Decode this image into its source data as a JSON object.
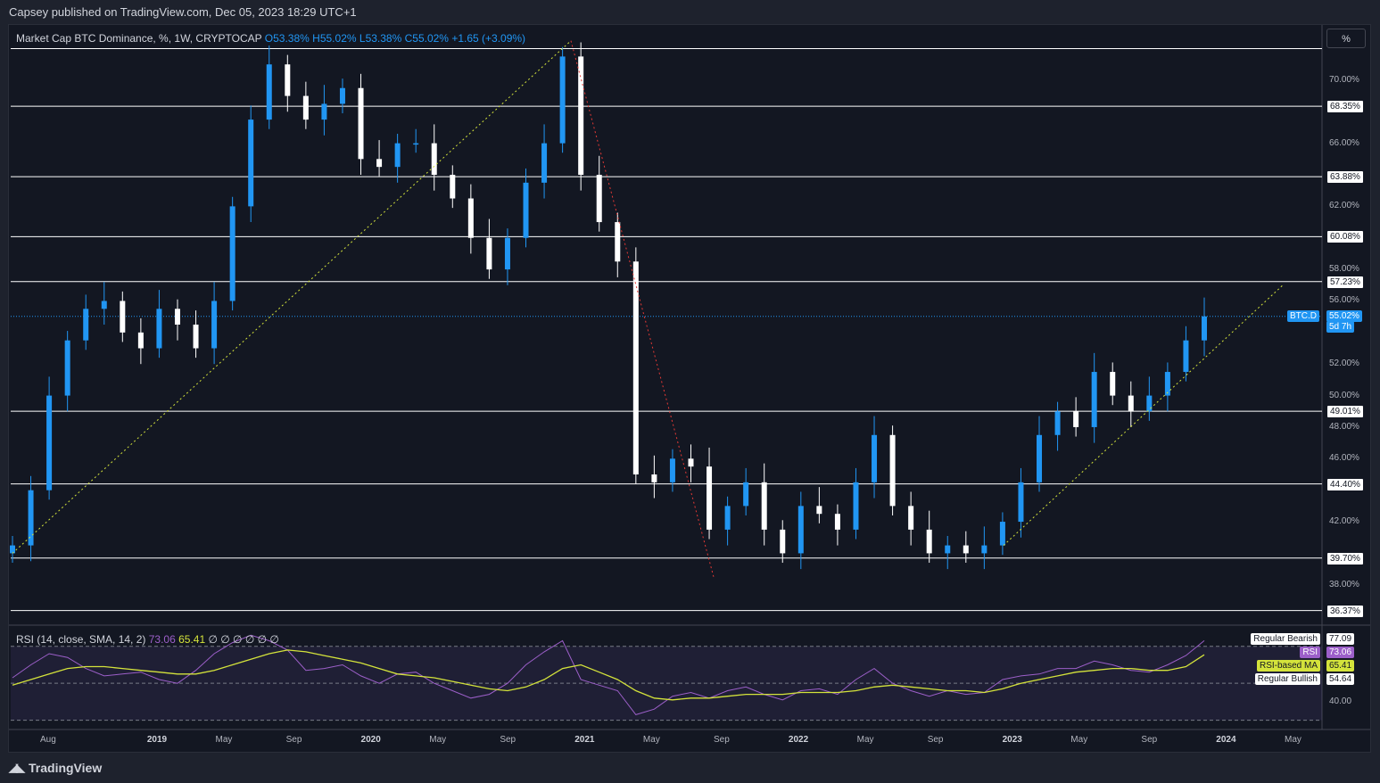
{
  "header": {
    "publisher": "Capsey published on TradingView.com, Dec 05, 2023 18:29 UTC+1"
  },
  "legend": {
    "symbol": "Market Cap BTC Dominance, %, 1W, CRYPTOCAP",
    "open": "O53.38%",
    "high": "H55.02%",
    "low": "L53.38%",
    "close": "C55.02%",
    "change": "+1.65 (+3.09%)"
  },
  "scale_button": "%",
  "footer": {
    "brand": "TradingView"
  },
  "rsi_legend": {
    "title": "RSI (14, close, SMA, 14, 2)",
    "rsi_value": "73.06",
    "ma_value": "65.41",
    "empties": "∅ ∅ ∅ ∅ ∅ ∅"
  },
  "colors": {
    "up": "#2196f3",
    "down": "#ffffff",
    "rsi": "#9c5fc9",
    "rsi_ma": "#d4e33b",
    "hline": "#ffffff",
    "dotted_up": "#d4e33b",
    "dotted_down": "#e53935"
  },
  "price_axis": [
    "70.00%",
    "66.00%",
    "62.00%",
    "58.00%",
    "56.00%",
    "52.00%",
    "50.00%",
    "48.00%",
    "46.00%",
    "42.00%",
    "38.00%"
  ],
  "hlines": [
    {
      "value": 72.0,
      "label": ""
    },
    {
      "value": 68.35,
      "label": "68.35%"
    },
    {
      "value": 63.88,
      "label": "63.88%"
    },
    {
      "value": 60.08,
      "label": "60.08%"
    },
    {
      "value": 57.23,
      "label": "57.23%"
    },
    {
      "value": 49.01,
      "label": "49.01%"
    },
    {
      "value": 44.4,
      "label": "44.40%"
    },
    {
      "value": 39.7,
      "label": "39.70%"
    },
    {
      "value": 36.37,
      "label": "36.37%"
    }
  ],
  "current_price": {
    "symbol": "BTC.D",
    "value": "55.02%",
    "countdown": "5d 7h",
    "level": 55.02
  },
  "rsi_tags": [
    {
      "name": "Regular Bearish",
      "value": "77.09"
    },
    {
      "name": "RSI",
      "value": "73.06"
    },
    {
      "name": "RSI-based MA",
      "value": "65.41"
    },
    {
      "name": "Regular Bullish",
      "value": "54.64"
    }
  ],
  "rsi_axis": [
    "40.00"
  ],
  "time_axis": [
    {
      "label": "Aug",
      "t": 0.0
    },
    {
      "label": "2019",
      "t": 0.5
    },
    {
      "label": "May",
      "t": 0.82
    },
    {
      "label": "Sep",
      "t": 1.15
    },
    {
      "label": "2020",
      "t": 1.5
    },
    {
      "label": "May",
      "t": 1.82
    },
    {
      "label": "Sep",
      "t": 2.15
    },
    {
      "label": "2021",
      "t": 2.5
    },
    {
      "label": "May",
      "t": 2.82
    },
    {
      "label": "Sep",
      "t": 3.15
    },
    {
      "label": "2022",
      "t": 3.5
    },
    {
      "label": "May",
      "t": 3.82
    },
    {
      "label": "Sep",
      "t": 4.15
    },
    {
      "label": "2023",
      "t": 4.5
    },
    {
      "label": "May",
      "t": 4.82
    },
    {
      "label": "Sep",
      "t": 5.15
    },
    {
      "label": "2024",
      "t": 5.5
    },
    {
      "label": "May",
      "t": 5.82
    }
  ],
  "chart_data": {
    "type": "line",
    "title": "Market Cap BTC Dominance, %, 1W, CRYPTOCAP",
    "xlabel": "",
    "ylabel": "",
    "ylim": [
      35.5,
      73.5
    ],
    "x": [
      "2018-07",
      "2018-08",
      "2018-09",
      "2018-10",
      "2018-11",
      "2018-12",
      "2019-01",
      "2019-02",
      "2019-03",
      "2019-04",
      "2019-05",
      "2019-06",
      "2019-07",
      "2019-08",
      "2019-09",
      "2019-10",
      "2019-11",
      "2019-12",
      "2020-01",
      "2020-02",
      "2020-03",
      "2020-04",
      "2020-05",
      "2020-06",
      "2020-07",
      "2020-08",
      "2020-09",
      "2020-10",
      "2020-11",
      "2020-12",
      "2021-01",
      "2021-02",
      "2021-03",
      "2021-04",
      "2021-05",
      "2021-06",
      "2021-07",
      "2021-08",
      "2021-09",
      "2021-10",
      "2021-11",
      "2021-12",
      "2022-01",
      "2022-02",
      "2022-03",
      "2022-04",
      "2022-05",
      "2022-06",
      "2022-07",
      "2022-08",
      "2022-09",
      "2022-10",
      "2022-11",
      "2022-12",
      "2023-01",
      "2023-02",
      "2023-03",
      "2023-04",
      "2023-05",
      "2023-06",
      "2023-07",
      "2023-08",
      "2023-09",
      "2023-10",
      "2023-11",
      "2023-12"
    ],
    "series": [
      {
        "values": [
          40.5,
          44.0,
          50.0,
          53.5,
          55.5,
          56.0,
          54.0,
          53.0,
          55.5,
          54.5,
          53.0,
          56.0,
          62.0,
          67.5,
          71.0,
          69.0,
          67.5,
          68.5,
          69.5,
          65.0,
          64.5,
          66.0,
          66.0,
          64.0,
          62.5,
          60.0,
          58.0,
          60.0,
          63.5,
          66.0,
          71.5,
          64.0,
          61.0,
          58.5,
          45.0,
          44.5,
          46.0,
          45.5,
          41.5,
          43.0,
          44.5,
          41.5,
          40.0,
          43.0,
          42.5,
          41.5,
          44.5,
          47.5,
          43.0,
          41.5,
          40.0,
          40.5,
          40.0,
          40.5,
          42.0,
          44.5,
          47.5,
          49.0,
          48.0,
          51.5,
          50.0,
          49.0,
          50.0,
          51.5,
          53.5,
          55.02
        ]
      }
    ],
    "rsi": {
      "values": [
        53,
        60,
        66,
        64,
        58,
        54,
        55,
        56,
        52,
        50,
        57,
        66,
        72,
        76,
        73,
        68,
        57,
        58,
        60,
        54,
        50,
        55,
        56,
        50,
        46,
        42,
        44,
        50,
        60,
        67,
        73,
        52,
        49,
        46,
        33,
        36,
        43,
        45,
        42,
        46,
        48,
        44,
        41,
        46,
        47,
        44,
        52,
        58,
        50,
        46,
        43,
        46,
        44,
        45,
        52,
        54,
        55,
        58,
        58,
        62,
        60,
        57,
        56,
        60,
        65,
        73.06
      ],
      "ma_values": [
        49,
        52,
        55,
        58,
        59,
        59,
        58,
        57,
        56,
        55,
        55,
        57,
        60,
        63,
        66,
        68,
        67,
        65,
        63,
        61,
        58,
        55,
        54,
        53,
        51,
        49,
        47,
        46,
        48,
        52,
        58,
        60,
        56,
        52,
        46,
        42,
        41,
        42,
        42,
        43,
        44,
        44,
        44,
        45,
        45,
        45,
        46,
        48,
        49,
        48,
        47,
        46,
        46,
        45,
        47,
        50,
        52,
        54,
        56,
        57,
        58,
        58,
        57,
        57,
        59,
        65.41
      ],
      "levels": [
        70,
        50,
        30
      ]
    }
  }
}
